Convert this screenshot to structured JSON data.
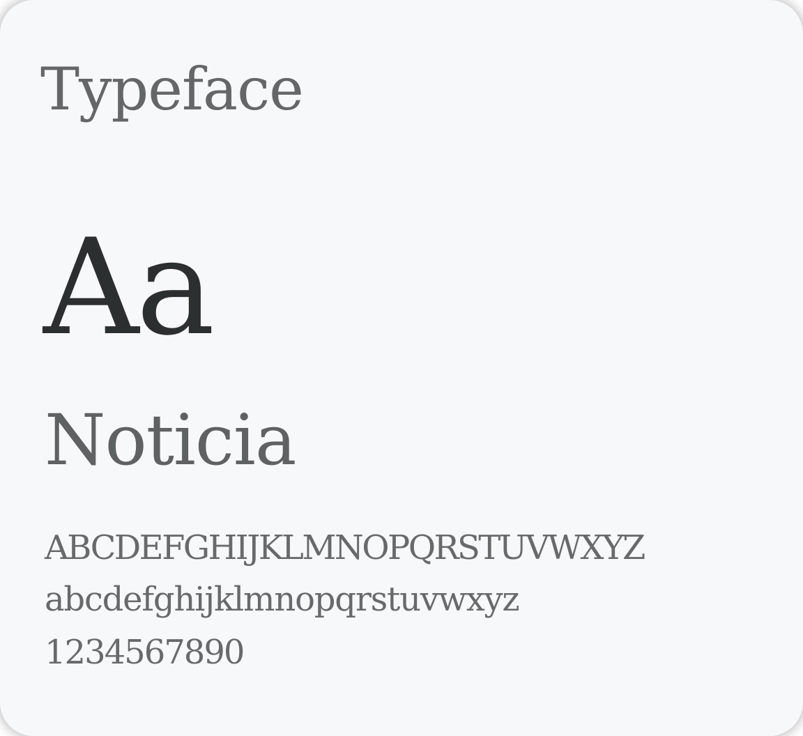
{
  "card": {
    "label": "Typeface",
    "specimen": "Aa",
    "font_name": "Noticia",
    "uppercase": "ABCDEFGHIJKLMNOPQRSTUVWXYZ",
    "lowercase": "abcdefghijklmnopqrstuvwxyz",
    "digits": "1234567890"
  },
  "colors": {
    "card_background": "#f7f8fa",
    "heading_text": "#646768",
    "specimen_text": "#2c2f2f",
    "body_text": "#676a6b"
  }
}
